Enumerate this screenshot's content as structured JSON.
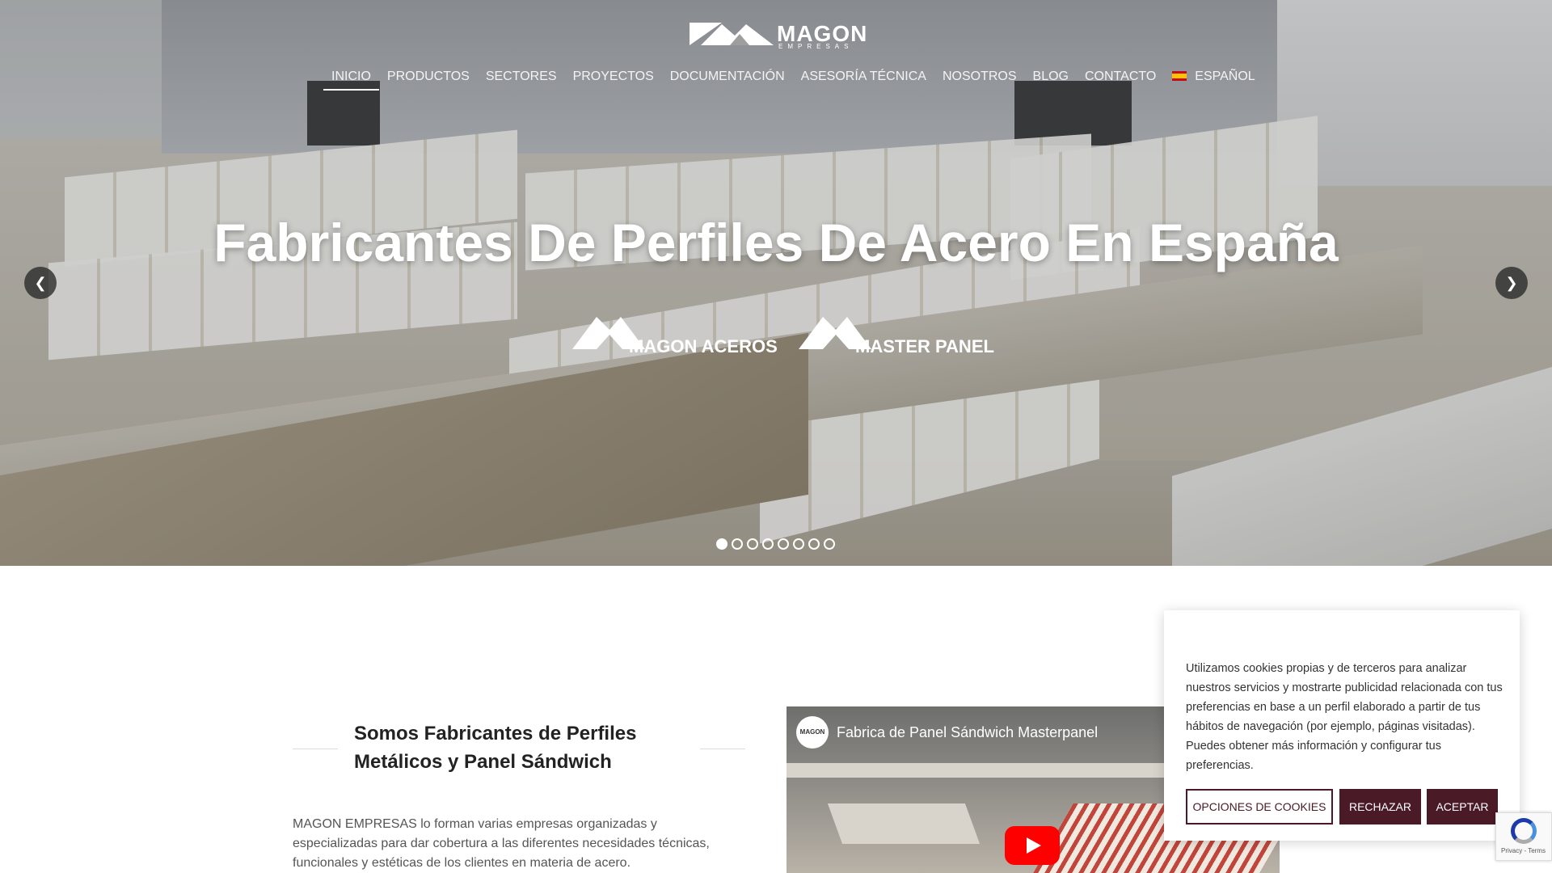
{
  "logo": {
    "name": "MAGON",
    "subtitle": "EMPRESAS"
  },
  "nav": {
    "items": [
      "INICIO",
      "PRODUCTOS",
      "SECTORES",
      "PROYECTOS",
      "DOCUMENTACIÓN",
      "ASESORÍA TÉCNICA",
      "NOSOTROS",
      "BLOG",
      "CONTACTO"
    ],
    "language": "ESPAÑOL",
    "active_index": 0
  },
  "hero": {
    "headline": "Fabricantes De Perfiles De Acero En España",
    "brands": [
      "MAGON ACEROS",
      "MASTER PANEL"
    ],
    "slide_count": 8,
    "active_slide": 1
  },
  "about": {
    "title": "Somos Fabricantes de Perfiles Metálicos y Panel Sándwich",
    "body": "MAGON EMPRESAS lo forman varias empresas organizadas y especializadas para dar cobertura a las diferentes necesidades técnicas, funcionales y estéticas de los clientes en materia de acero."
  },
  "video": {
    "title": "Fabrica de Panel Sándwich Masterpanel",
    "channel_avatar_text": "MAGON"
  },
  "cookie": {
    "text": "Utilizamos cookies propias y de terceros para analizar nuestros servicios y mostrarte publicidad relacionada con tus preferencias en base a un perfil elaborado a partir de tus hábitos de navegación (por ejemplo, páginas visitadas). Puedes obtener más información y configurar tus preferencias.",
    "options_label": "OPCIONES DE COOKIES",
    "reject_label": "RECHAZAR",
    "accept_label": "ACEPTAR"
  },
  "recaptcha": {
    "links": "Privacy - Terms"
  },
  "colors": {
    "accent": "#4a1a26",
    "youtube": "#ff0000"
  }
}
